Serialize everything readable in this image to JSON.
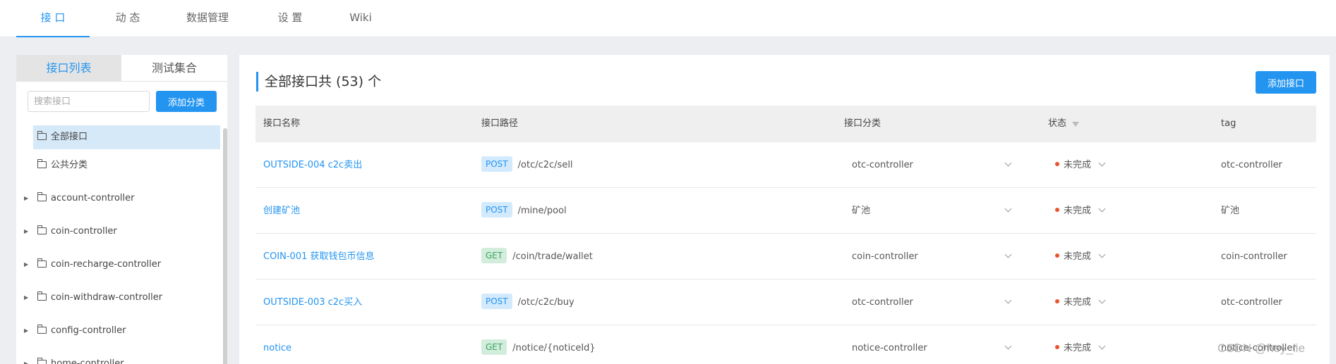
{
  "nav": {
    "tabs": [
      {
        "label": "接 口"
      },
      {
        "label": "动 态"
      },
      {
        "label": "数据管理"
      },
      {
        "label": "设 置"
      },
      {
        "label": "Wiki"
      }
    ]
  },
  "sidebar": {
    "tab_list": "接口列表",
    "tab_collection": "测试集合",
    "search_placeholder": "搜索接口",
    "add_category": "添加分类",
    "items": [
      {
        "label": "全部接口"
      },
      {
        "label": "公共分类"
      },
      {
        "label": "account-controller"
      },
      {
        "label": "coin-controller"
      },
      {
        "label": "coin-recharge-controller"
      },
      {
        "label": "coin-withdraw-controller"
      },
      {
        "label": "config-controller"
      },
      {
        "label": "home-controller"
      }
    ]
  },
  "main": {
    "title": "全部接口共 (53) 个",
    "add_api": "添加接口",
    "columns": {
      "name": "接口名称",
      "path": "接口路径",
      "category": "接口分类",
      "status": "状态",
      "tag": "tag"
    },
    "rows": [
      {
        "name": "OUTSIDE-004 c2c卖出",
        "method": "POST",
        "path": "/otc/c2c/sell",
        "category": "otc-controller",
        "status": "未完成",
        "tag": "otc-controller"
      },
      {
        "name": "创建矿池",
        "method": "POST",
        "path": "/mine/pool",
        "category": "矿池",
        "status": "未完成",
        "tag": "矿池"
      },
      {
        "name": "COIN-001 获取钱包币信息",
        "method": "GET",
        "path": "/coin/trade/wallet",
        "category": "coin-controller",
        "status": "未完成",
        "tag": "coin-controller"
      },
      {
        "name": "OUTSIDE-003 c2c买入",
        "method": "POST",
        "path": "/otc/c2c/buy",
        "category": "otc-controller",
        "status": "未完成",
        "tag": "otc-controller"
      },
      {
        "name": "notice",
        "method": "GET",
        "path": "/notice/{noticeId}",
        "category": "notice-controller",
        "status": "未完成",
        "tag": "notice-controller"
      }
    ]
  },
  "colors": {
    "accent": "#2395f1",
    "status_dot": "#e8542d"
  },
  "watermark": "CSDN @hey_lie"
}
